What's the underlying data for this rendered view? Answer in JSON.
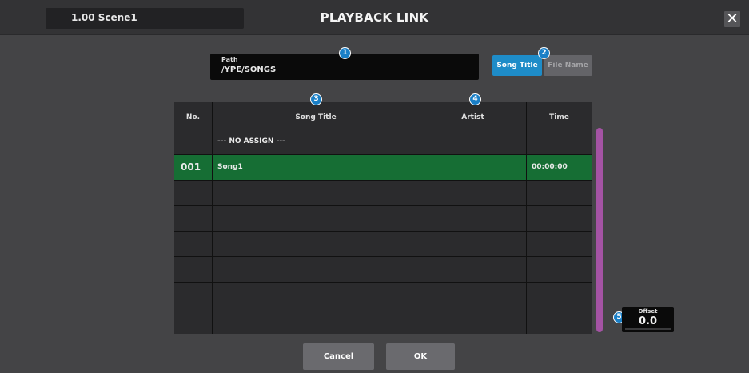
{
  "titlebar": {
    "scene": "1.00  Scene1",
    "title": "PLAYBACK LINK",
    "close_symbol": "✕"
  },
  "path": {
    "label": "Path",
    "value": "/YPE/SONGS"
  },
  "display_mode": {
    "song_title_label": "Song Title",
    "file_name_label": "File Name",
    "selected": "Song Title"
  },
  "callouts": [
    "1",
    "2",
    "3",
    "4",
    "5"
  ],
  "table": {
    "columns": [
      "No.",
      "Song Title",
      "Artist",
      "Time"
    ],
    "rows": [
      {
        "no": "",
        "title": "--- NO ASSIGN ---",
        "artist": "",
        "time": ""
      },
      {
        "no": "001",
        "title": "Song1",
        "artist": "",
        "time": "00:00:00",
        "selected": true
      },
      {
        "no": "",
        "title": "",
        "artist": "",
        "time": ""
      },
      {
        "no": "",
        "title": "",
        "artist": "",
        "time": ""
      },
      {
        "no": "",
        "title": "",
        "artist": "",
        "time": ""
      },
      {
        "no": "",
        "title": "",
        "artist": "",
        "time": ""
      },
      {
        "no": "",
        "title": "",
        "artist": "",
        "time": ""
      },
      {
        "no": "",
        "title": "",
        "artist": "",
        "time": ""
      }
    ]
  },
  "offset": {
    "label": "Offset",
    "value": "0.0"
  },
  "footer": {
    "cancel_label": "Cancel",
    "ok_label": "OK"
  },
  "colors": {
    "accent": "#1e8cc8",
    "selected_row": "#166e34",
    "scrollbar": "#a453a4",
    "badge": "#1a7fc6"
  }
}
